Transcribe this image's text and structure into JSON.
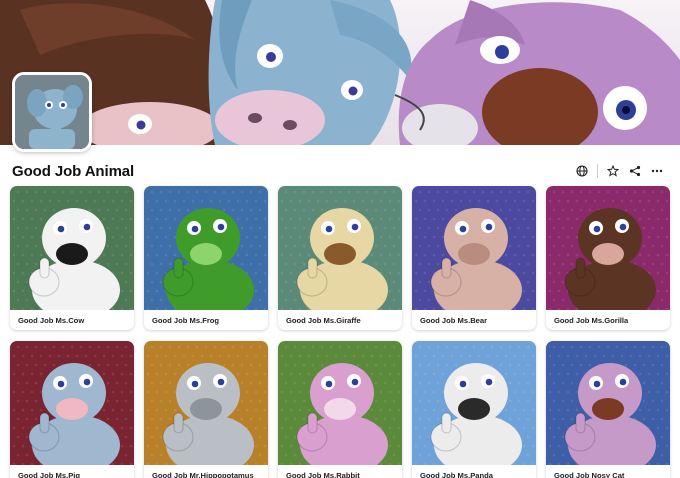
{
  "page": {
    "title": "Good Job Animal"
  },
  "banner": {
    "description_icon": "banner-animals-image",
    "avatar_icon": "avatar-elephant-image"
  },
  "actions": [
    {
      "name": "globe-button",
      "icon": "globe-icon"
    },
    {
      "name": "star-button",
      "icon": "star-icon"
    },
    {
      "name": "share-button",
      "icon": "share-icon"
    },
    {
      "name": "more-button",
      "icon": "more-horizontal-icon"
    }
  ],
  "items": [
    {
      "name": "Good Job Ms.Cow",
      "bg": "#4d7a55",
      "body": "#f2f2f2",
      "accent": "#1a1a1a"
    },
    {
      "name": "Good Job Ms.Frog",
      "bg": "#3f6fa8",
      "body": "#3f9c2a",
      "accent": "#8dd46a"
    },
    {
      "name": "Good Job Ms.Giraffe",
      "bg": "#5c8a78",
      "body": "#e6d7a4",
      "accent": "#8a5a2b"
    },
    {
      "name": "Good Job Ms.Bear",
      "bg": "#4b4aa0",
      "body": "#d7b0a6",
      "accent": "#b88d80"
    },
    {
      "name": "Good Job Ms.Gorilla",
      "bg": "#8a2a6a",
      "body": "#5b3424",
      "accent": "#d9a69b"
    },
    {
      "name": "Good Job Ms.Pig",
      "bg": "#7a2432",
      "body": "#9fb8d0",
      "accent": "#f0b8c0"
    },
    {
      "name": "Good Job Mr.Hippopotamus",
      "bg": "#b88028",
      "body": "#b9bfc4",
      "accent": "#8d949a"
    },
    {
      "name": "Good Job Ms.Rabbit",
      "bg": "#5b8a3a",
      "body": "#d9a0cf",
      "accent": "#f3d8ea"
    },
    {
      "name": "Good Job Ms.Panda",
      "bg": "#6fa2d8",
      "body": "#ececec",
      "accent": "#2a2a2a"
    },
    {
      "name": "Good Job Nosy Cat",
      "bg": "#3f5ea8",
      "body": "#c69ac8",
      "accent": "#7a3a24"
    }
  ]
}
